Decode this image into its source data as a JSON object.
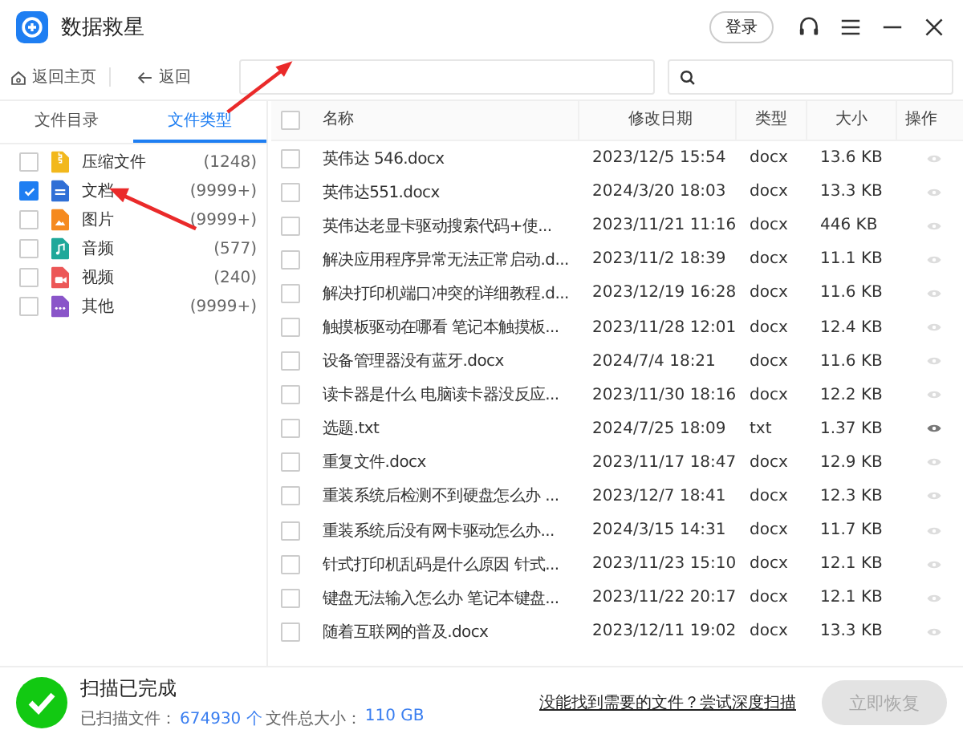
{
  "window": {
    "title": "数据救星",
    "login": "登录"
  },
  "toolbar": {
    "home": "返回主页",
    "back": "返回"
  },
  "tabs": [
    {
      "label": "文件目录",
      "selected": false
    },
    {
      "label": "文件类型",
      "selected": true
    }
  ],
  "categories": [
    {
      "label": "压缩文件",
      "count": "(1248)",
      "checked": false,
      "color": "#f2b81c",
      "kind": "zip"
    },
    {
      "label": "文档",
      "count": "(9999+)",
      "checked": true,
      "color": "#2f6fd6",
      "kind": "doc"
    },
    {
      "label": "图片",
      "count": "(9999+)",
      "checked": false,
      "color": "#f58a1f",
      "kind": "image"
    },
    {
      "label": "音频",
      "count": "(577)",
      "checked": false,
      "color": "#1fa89a",
      "kind": "audio"
    },
    {
      "label": "视频",
      "count": "(240)",
      "checked": false,
      "color": "#ec5757",
      "kind": "video"
    },
    {
      "label": "其他",
      "count": "(9999+)",
      "checked": false,
      "color": "#8a55c9",
      "kind": "other"
    }
  ],
  "table": {
    "select_all_checked": false,
    "columns": [
      "名称",
      "修改日期",
      "类型",
      "大小",
      "操作"
    ],
    "rows": [
      {
        "checked": false,
        "name": "英伟达 546.docx",
        "date": "2023/12/5 15:54",
        "type": "docx",
        "size": "13.6 KB",
        "preview": false
      },
      {
        "checked": false,
        "name": "英伟达551.docx",
        "date": "2024/3/20 18:03",
        "type": "docx",
        "size": "13.3 KB",
        "preview": false
      },
      {
        "checked": false,
        "name": "英伟达老显卡驱动搜索代码+使...",
        "date": "2023/11/21 11:16",
        "type": "docx",
        "size": "446 KB",
        "preview": false
      },
      {
        "checked": false,
        "name": "解决应用程序异常无法正常启动.d...",
        "date": "2023/11/2 18:39",
        "type": "docx",
        "size": "11.1 KB",
        "preview": false
      },
      {
        "checked": false,
        "name": "解决打印机端口冲突的详细教程.d...",
        "date": "2023/12/19 16:28",
        "type": "docx",
        "size": "11.6 KB",
        "preview": false
      },
      {
        "checked": false,
        "name": "触摸板驱动在哪看 笔记本触摸板...",
        "date": "2023/11/28 12:01",
        "type": "docx",
        "size": "12.4 KB",
        "preview": false
      },
      {
        "checked": false,
        "name": "设备管理器没有蓝牙.docx",
        "date": "2024/7/4 18:21",
        "type": "docx",
        "size": "11.6 KB",
        "preview": false
      },
      {
        "checked": false,
        "name": "读卡器是什么 电脑读卡器没反应...",
        "date": "2023/11/30 18:16",
        "type": "docx",
        "size": "12.2 KB",
        "preview": false
      },
      {
        "checked": false,
        "name": "选题.txt",
        "date": "2024/7/25 18:09",
        "type": "txt",
        "size": "1.37 KB",
        "preview": true
      },
      {
        "checked": false,
        "name": "重复文件.docx",
        "date": "2023/11/17 18:47",
        "type": "docx",
        "size": "12.9 KB",
        "preview": false
      },
      {
        "checked": false,
        "name": "重装系统后检测不到硬盘怎么办 ...",
        "date": "2023/12/7 18:41",
        "type": "docx",
        "size": "12.3 KB",
        "preview": false
      },
      {
        "checked": false,
        "name": "重装系统后没有网卡驱动怎么办...",
        "date": "2024/3/15 14:31",
        "type": "docx",
        "size": "11.7 KB",
        "preview": false
      },
      {
        "checked": false,
        "name": "针式打印机乱码是什么原因 针式...",
        "date": "2023/11/23 15:10",
        "type": "docx",
        "size": "12.1 KB",
        "preview": false
      },
      {
        "checked": false,
        "name": "键盘无法输入怎么办 笔记本键盘...",
        "date": "2023/11/22 20:17",
        "type": "docx",
        "size": "12.1 KB",
        "preview": false
      },
      {
        "checked": false,
        "name": "随着互联网的普及.docx",
        "date": "2023/12/11 19:02",
        "type": "docx",
        "size": "13.3 KB",
        "preview": false
      }
    ]
  },
  "footer": {
    "status": "扫描已完成",
    "scanned_label": "已扫描文件：",
    "scanned_count": "674930 个",
    "size_label": "文件总大小：",
    "size_value": "110 GB",
    "deep_scan_link": "没能找到需要的文件？尝试深度扫描",
    "recover_button": {
      "label": "立即恢复",
      "disabled": true
    }
  }
}
